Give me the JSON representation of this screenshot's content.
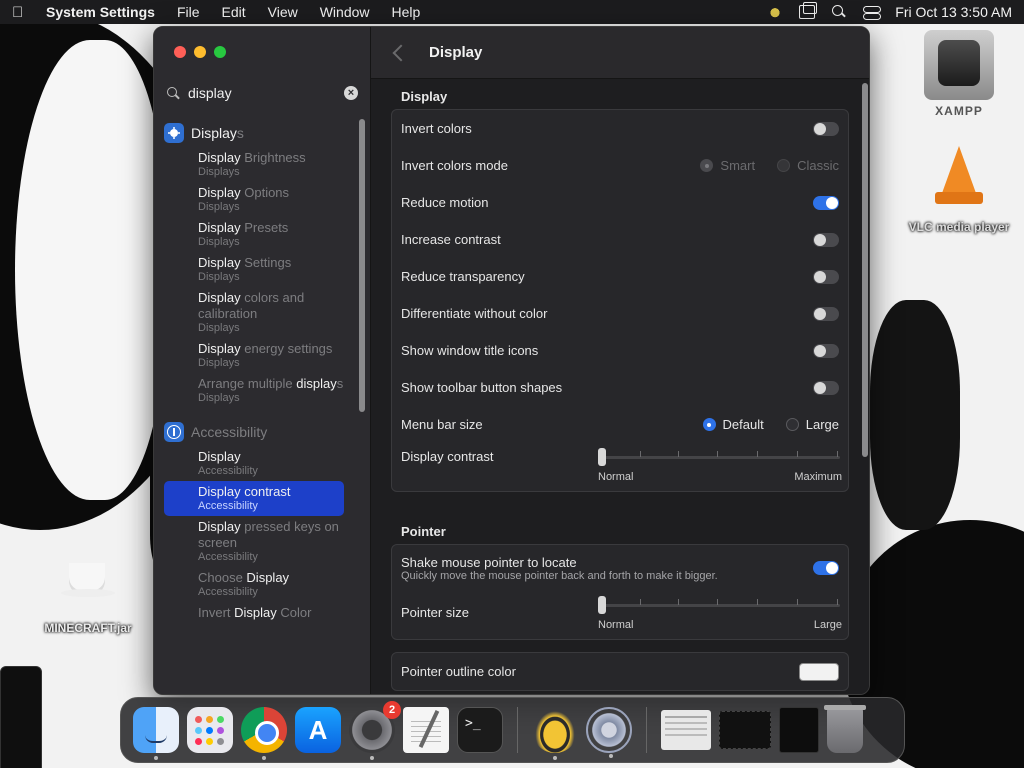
{
  "menubar": {
    "app_name": "System Settings",
    "menus": [
      "File",
      "Edit",
      "View",
      "Window",
      "Help"
    ],
    "clock": "Fri Oct 13  3:50 AM"
  },
  "desktop": {
    "icons": [
      {
        "label": "XAMPP"
      },
      {
        "label": "VLC media player"
      },
      {
        "label": "MINECRAFT.jar"
      }
    ]
  },
  "window": {
    "search": {
      "value": "display"
    },
    "sidebar": {
      "categories": [
        {
          "match": "Display",
          "rest": "s",
          "icon": "sun-icon"
        },
        {
          "name": "Accessibility",
          "icon": "accessibility-icon"
        }
      ],
      "display_results": [
        {
          "match": "Display",
          "rest": " Brightness",
          "sub": "Displays"
        },
        {
          "match": "Display",
          "rest": " Options",
          "sub": "Displays"
        },
        {
          "match": "Display",
          "rest": " Presets",
          "sub": "Displays"
        },
        {
          "match": "Display",
          "rest": " Settings",
          "sub": "Displays"
        },
        {
          "match": "Display",
          "rest": " colors and calibration",
          "sub": "Displays"
        },
        {
          "match": "Display",
          "rest": " energy settings",
          "sub": "Displays"
        },
        {
          "pre": "Arrange multiple ",
          "match": "display",
          "rest": "s",
          "sub": "Displays"
        }
      ],
      "accessibility_results": [
        {
          "match": "Display",
          "rest": "",
          "sub": "Accessibility"
        },
        {
          "match": "Display contrast",
          "rest": "",
          "sub": "Accessibility",
          "selected": true
        },
        {
          "match": "Display",
          "rest": " pressed keys on screen",
          "sub": "Accessibility"
        },
        {
          "pre": "Choose ",
          "match": "Display",
          "rest": "",
          "sub": "Accessibility"
        },
        {
          "pre": "Invert ",
          "match": "Display",
          "rest": " Color",
          "sub": ""
        }
      ]
    },
    "header": {
      "title": "Display"
    },
    "display_section": {
      "title": "Display",
      "invert_colors": {
        "label": "Invert colors",
        "on": false
      },
      "invert_mode": {
        "label": "Invert colors mode",
        "options": [
          "Smart",
          "Classic"
        ],
        "selected": "Smart"
      },
      "reduce_motion": {
        "label": "Reduce motion",
        "on": true
      },
      "increase_contrast": {
        "label": "Increase contrast",
        "on": false
      },
      "reduce_transparency": {
        "label": "Reduce transparency",
        "on": false
      },
      "differentiate": {
        "label": "Differentiate without color",
        "on": false
      },
      "title_icons": {
        "label": "Show window title icons",
        "on": false
      },
      "toolbar_shapes": {
        "label": "Show toolbar button shapes",
        "on": false
      },
      "menu_bar_size": {
        "label": "Menu bar size",
        "options": [
          "Default",
          "Large"
        ],
        "selected": "Default"
      },
      "contrast": {
        "label": "Display contrast",
        "min_label": "Normal",
        "max_label": "Maximum",
        "value": 0
      }
    },
    "pointer_section": {
      "title": "Pointer",
      "shake": {
        "label": "Shake mouse pointer to locate",
        "desc": "Quickly move the mouse pointer back and forth to make it bigger.",
        "on": true
      },
      "size": {
        "label": "Pointer size",
        "min_label": "Normal",
        "max_label": "Large",
        "value": 0
      },
      "outline": {
        "label": "Pointer outline color",
        "color": "#f2f2f2"
      }
    }
  },
  "dock": {
    "settings_badge": "2",
    "items": [
      "Finder",
      "Launchpad",
      "Google Chrome",
      "App Store",
      "System Settings",
      "TextEdit",
      "Terminal",
      "Bee",
      "Utility",
      "Window 1",
      "Window 2",
      "Window 3",
      "Trash"
    ]
  },
  "colors": {
    "accent": "#2e72e8",
    "selection": "#1d40c9"
  }
}
